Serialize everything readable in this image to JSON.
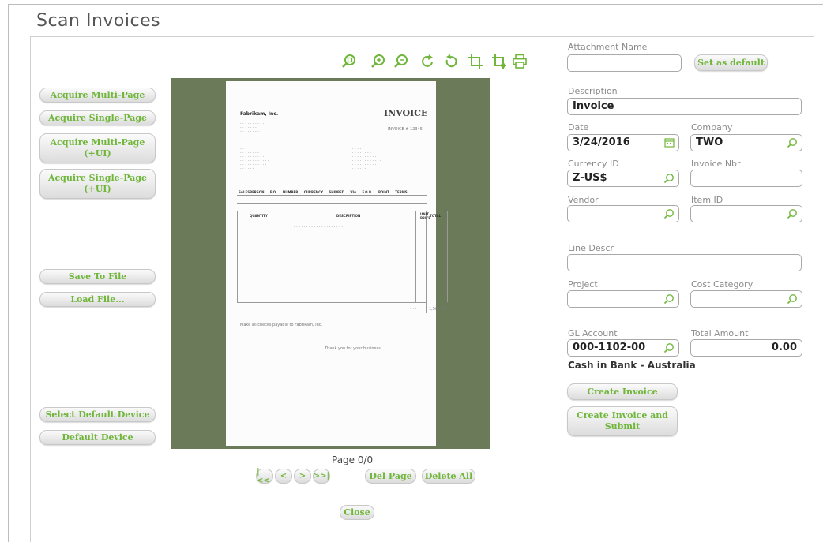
{
  "page": {
    "title": "Scan Invoices"
  },
  "left_buttons": {
    "acquire_multi": "Acquire Multi-Page",
    "acquire_single": "Acquire Single-Page",
    "acquire_multi_ui": "Acquire Multi-Page\n(+UI)",
    "acquire_single_ui": "Acquire Single-Page\n(+UI)",
    "save_to_file": "Save To File",
    "load_file": "Load File...",
    "select_default_device": "Select Default Device",
    "default_device": "Default Device"
  },
  "toolbar": {
    "icons": [
      "zoom-fit-icon",
      "zoom-in-icon",
      "zoom-out-icon",
      "rotate-cw-icon",
      "rotate-ccw-icon",
      "crop-icon",
      "crop-apply-icon",
      "print-icon"
    ]
  },
  "document": {
    "company": "Fabrikam, Inc.",
    "heading": "INVOICE",
    "invoice_meta": "INVOICE # 12345",
    "table1_headers": [
      "SALESPERSON",
      "P.O. NUMBER",
      "CURRENCY",
      "SHIPPED VIA",
      "F.O.B. POINT",
      "TERMS"
    ],
    "table2_headers": [
      "QUANTITY",
      "DESCRIPTION",
      "UNIT PRICE",
      "TOTAL"
    ],
    "total_value": "1,500.00",
    "footer_1": "Make all checks payable to Fabrikam, Inc.",
    "footer_2": "Thank you for your business!"
  },
  "pager": {
    "page_label": "Page 0/0",
    "first": "|<<",
    "prev": "<",
    "next": ">",
    "last": ">>|",
    "del_page": "Del Page",
    "delete_all": "Delete All",
    "close": "Close"
  },
  "form": {
    "attachment_name": {
      "label": "Attachment Name",
      "value": ""
    },
    "set_default": "Set as default",
    "description": {
      "label": "Description",
      "value": "Invoice"
    },
    "date": {
      "label": "Date",
      "value": "3/24/2016"
    },
    "company": {
      "label": "Company",
      "value": "TWO"
    },
    "currency_id": {
      "label": "Currency ID",
      "value": "Z-US$"
    },
    "invoice_nbr": {
      "label": "Invoice Nbr",
      "value": ""
    },
    "vendor": {
      "label": "Vendor",
      "value": ""
    },
    "item_id": {
      "label": "Item ID",
      "value": ""
    },
    "line_descr": {
      "label": "Line Descr",
      "value": ""
    },
    "project": {
      "label": "Project",
      "value": ""
    },
    "cost_category": {
      "label": "Cost Category",
      "value": ""
    },
    "gl_account": {
      "label": "GL Account",
      "value": "000-1102-00",
      "desc": "Cash in Bank - Australia"
    },
    "total_amount": {
      "label": "Total Amount",
      "value": "0.00"
    },
    "create_invoice": "Create Invoice",
    "create_invoice_submit": "Create Invoice and\nSubmit"
  },
  "colors": {
    "accent": "#70b63b",
    "viewer_bg": "#6b7b5a"
  }
}
